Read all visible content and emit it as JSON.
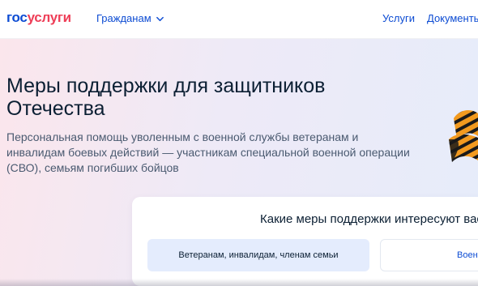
{
  "header": {
    "logo_part1": "гос",
    "logo_part2": "услуги",
    "nav_citizens": "Гражданам",
    "nav_services": "Услуги",
    "nav_documents": "Документы"
  },
  "hero": {
    "title": "Меры поддержки для защитников Отечества",
    "subtitle": "Персональная помощь уволенным с военной службы ветеранам и инвалидам боевых действий — участникам специальной военной операции (СВО), семьям погибших бойцов"
  },
  "support": {
    "question": "Какие меры поддержки интересуют вас?",
    "options": [
      "Ветеранам, инвалидам, членам семьи",
      "Военнослужащим"
    ]
  },
  "colors": {
    "brand_blue": "#0d4cd3",
    "brand_red": "#ee3f58",
    "ribbon_orange": "#f29a1f",
    "ribbon_black": "#1a1a1a"
  },
  "icons": {
    "nav_chevron": "chevron-down-icon",
    "hero_image": "st-george-ribbon-icon"
  }
}
